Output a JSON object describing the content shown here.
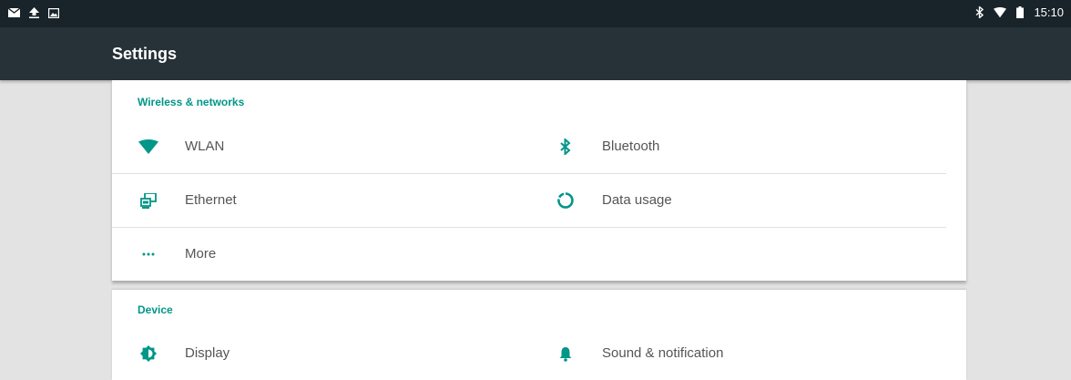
{
  "status_bar": {
    "left_icons": [
      "mail-icon",
      "upload-icon",
      "image-icon"
    ],
    "right_icons": [
      "bluetooth-icon",
      "wifi-icon",
      "battery-icon"
    ],
    "time": "15:10"
  },
  "app_bar": {
    "title": "Settings"
  },
  "sections": [
    {
      "title": "Wireless & networks",
      "items": [
        {
          "label": "WLAN",
          "icon": "wifi-icon"
        },
        {
          "label": "Bluetooth",
          "icon": "bluetooth-icon"
        },
        {
          "label": "Ethernet",
          "icon": "ethernet-icon"
        },
        {
          "label": "Data usage",
          "icon": "data-usage-icon"
        },
        {
          "label": "More",
          "icon": "more-icon"
        }
      ]
    },
    {
      "title": "Device",
      "items": [
        {
          "label": "Display",
          "icon": "display-icon"
        },
        {
          "label": "Sound & notification",
          "icon": "bell-icon"
        }
      ]
    }
  ],
  "colors": {
    "accent": "#009688",
    "app_bar": "#263238",
    "status_bar": "#19242a",
    "background": "#e3e3e3"
  }
}
